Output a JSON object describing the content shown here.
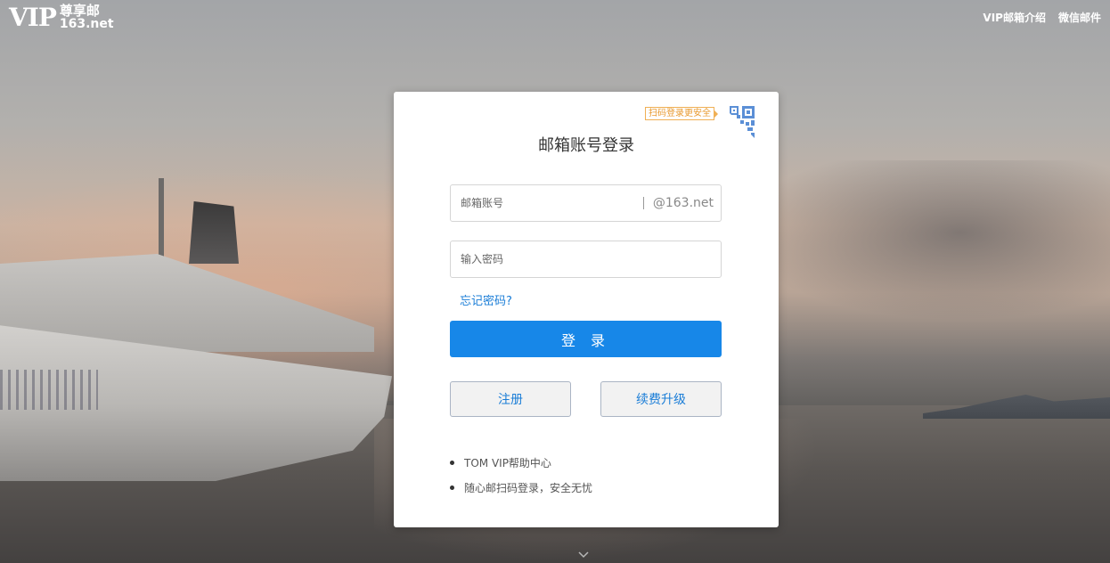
{
  "header": {
    "logo_vip": "VIP",
    "logo_cn": "尊享邮",
    "logo_domain": "163.net",
    "nav": [
      {
        "label": "VIP邮箱介绍"
      },
      {
        "label": "微信邮件"
      }
    ]
  },
  "login": {
    "qr_tip": "扫码登录更安全",
    "title": "邮箱账号登录",
    "account_placeholder": "邮箱账号",
    "account_value": "",
    "domain_suffix": "@163.net",
    "password_placeholder": "输入密码",
    "password_value": "",
    "forgot_label": "忘记密码?",
    "login_button": "登 录",
    "register_button": "注册",
    "renew_button": "续费升级",
    "links": [
      {
        "label": "TOM VIP帮助中心"
      },
      {
        "label": "随心邮扫码登录，安全无忧"
      }
    ]
  },
  "colors": {
    "accent": "#1787e8",
    "link": "#1a7dd7",
    "qr_tip_border": "#f0b055"
  },
  "icons": {
    "qr": "qr-code-icon",
    "scroll": "chevron-down-icon"
  }
}
